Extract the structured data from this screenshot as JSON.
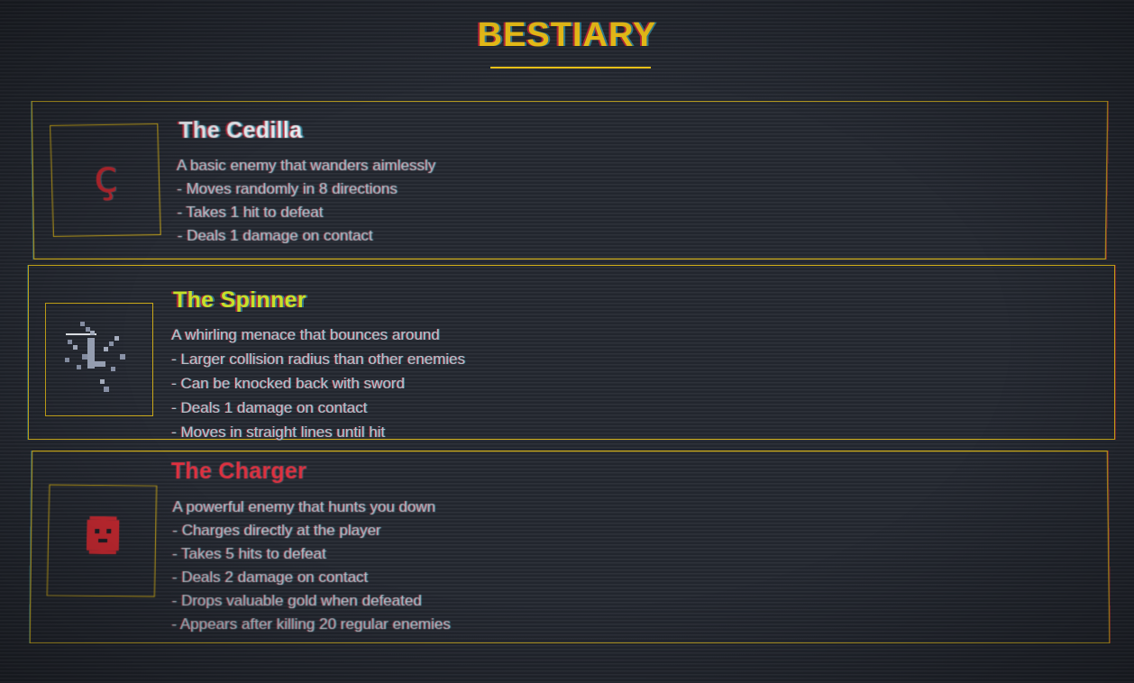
{
  "header": {
    "title": "BESTIARY"
  },
  "colors": {
    "background": "#262a33",
    "accent_gold": "#f0c419",
    "frame": "#d4b21a",
    "enemy_red": "#b8262e",
    "spinner_name": "#c6e02a",
    "charger_name": "#e0303f"
  },
  "enemies": [
    {
      "name": "The Cedilla",
      "icon": "cedilla-glyph-icon",
      "glyph": "ç",
      "lines": [
        "A basic enemy that wanders aimlessly",
        "- Moves randomly in 8 directions",
        "- Takes 1 hit to defeat",
        "- Deals 1 damage on contact"
      ]
    },
    {
      "name": "The Spinner",
      "icon": "spinner-sprite-icon",
      "lines": [
        "A whirling menace that bounces around",
        "- Larger collision radius than other enemies",
        "- Can be knocked back with sword",
        "- Deals 1 damage on contact",
        "- Moves in straight lines until hit"
      ]
    },
    {
      "name": "The Charger",
      "icon": "charger-sprite-icon",
      "lines": [
        "A powerful enemy that hunts you down",
        "- Charges directly at the player",
        "- Takes 5 hits to defeat",
        "- Deals 2 damage on contact",
        "- Drops valuable gold when defeated",
        "- Appears after killing 20 regular enemies"
      ]
    }
  ]
}
